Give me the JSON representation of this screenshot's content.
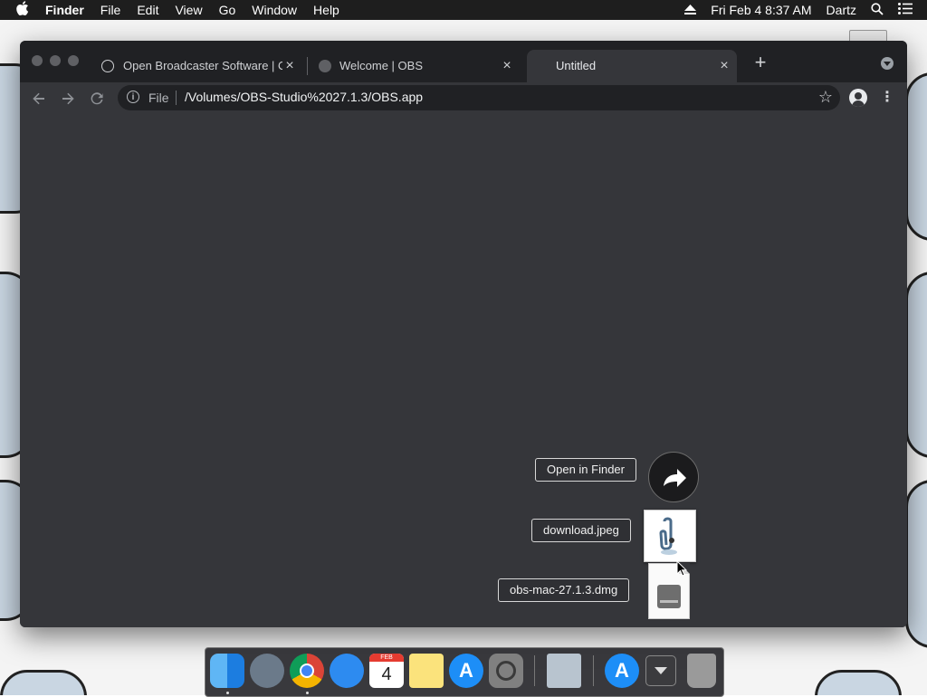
{
  "menubar": {
    "app": "Finder",
    "items": [
      "File",
      "Edit",
      "View",
      "Go",
      "Window",
      "Help"
    ],
    "datetime": "Fri Feb 4  8:37 AM",
    "user": "Dartz"
  },
  "browser": {
    "tabs": [
      {
        "label": "Open Broadcaster Software | O"
      },
      {
        "label": "Welcome | OBS"
      },
      {
        "label": "Untitled"
      }
    ],
    "address": {
      "scheme": "File",
      "url": "/Volumes/OBS-Studio%2027.1.3/OBS.app"
    }
  },
  "stack": {
    "items": [
      {
        "label": "Open in Finder"
      },
      {
        "label": "download.jpeg"
      },
      {
        "label": "obs-mac-27.1.3.dmg"
      }
    ]
  },
  "dock": {
    "items": [
      "finder-icon",
      "launchpad-icon",
      "chrome-icon",
      "safari-icon",
      "calendar-icon",
      "notes-icon",
      "app-store-icon",
      "system-preferences-icon",
      "preview-icon",
      "applications-folder-icon",
      "downloads-stack-icon",
      "trash-icon"
    ],
    "calendar": {
      "month": "FEB",
      "day": "4"
    }
  },
  "colors": {
    "window_bg": "#35363a",
    "tabstrip_bg": "#202124",
    "menubar_bg": "#1e1e1e"
  }
}
